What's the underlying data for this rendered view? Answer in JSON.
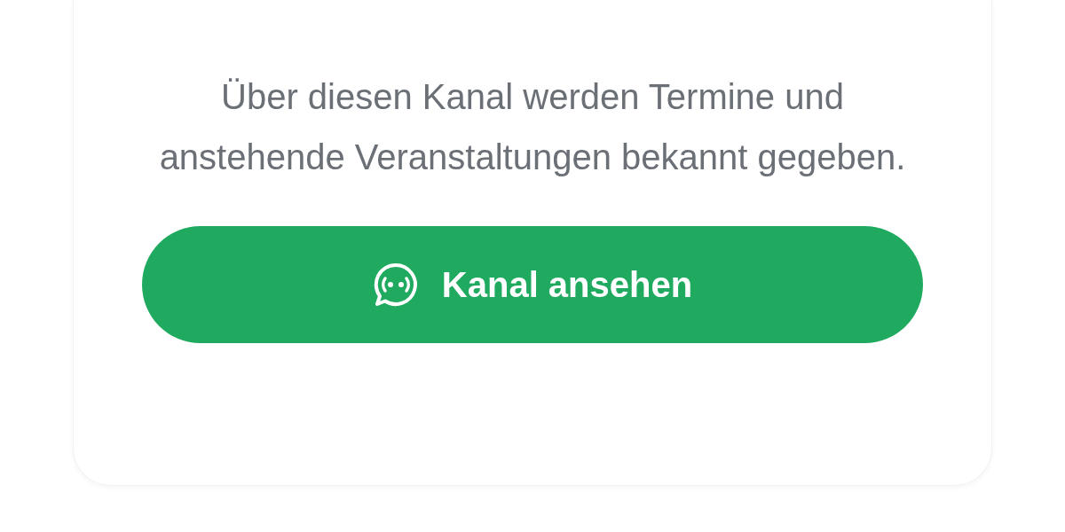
{
  "card": {
    "description": "Über diesen Kanal werden Termine und anstehende Veranstaltungen bekannt gegeben.",
    "button": {
      "label": "Kanal ansehen"
    }
  }
}
